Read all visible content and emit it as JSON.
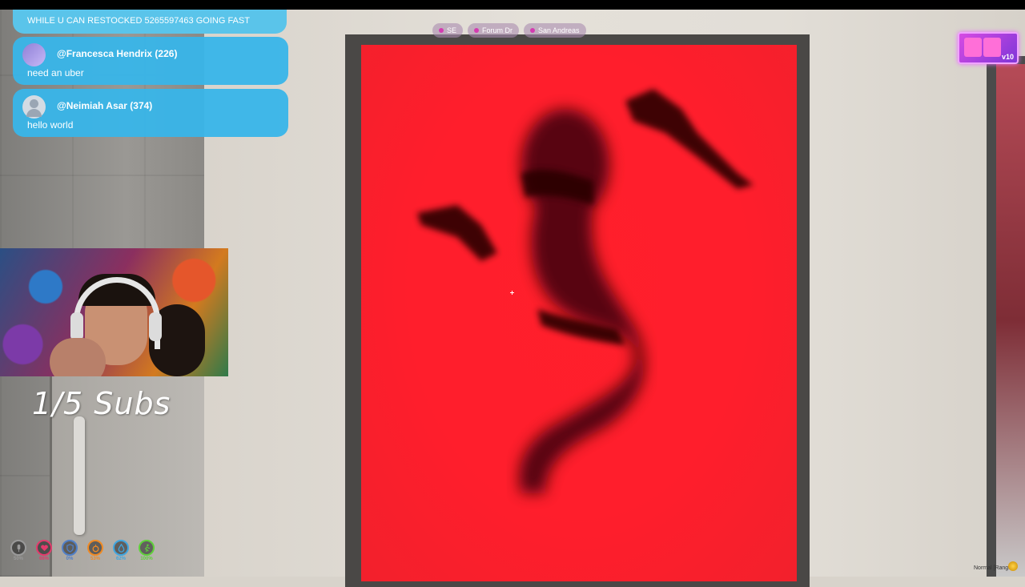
{
  "location_bar": [
    {
      "label": "SE"
    },
    {
      "label": "Forum Dr"
    },
    {
      "label": "San Andreas"
    }
  ],
  "logo": {
    "version": "v10"
  },
  "chat": {
    "ticker": "WHILE U CAN RESTOCKED 5265597463 GOING FAST",
    "messages": [
      {
        "user": "@Francesca Hendrix (226)",
        "text": "need an uber"
      },
      {
        "user": "@Neimiah Asar (374)",
        "text": "hello world"
      }
    ]
  },
  "overlay": {
    "subs_goal": "1/5 Subs"
  },
  "hud": [
    {
      "icon": "microphone-icon",
      "value": "50%",
      "color": "#9a9a9a"
    },
    {
      "icon": "heart-icon",
      "value": "66%",
      "color": "#e33a6c"
    },
    {
      "icon": "shield-icon",
      "value": "0%",
      "color": "#4f7fc8"
    },
    {
      "icon": "food-icon",
      "value": "53%",
      "color": "#f08a24"
    },
    {
      "icon": "water-icon",
      "value": "62%",
      "color": "#3fa6e0"
    },
    {
      "icon": "stamina-icon",
      "value": "100%",
      "color": "#5fd13a"
    }
  ],
  "voice_mode": "Normal [Range]"
}
